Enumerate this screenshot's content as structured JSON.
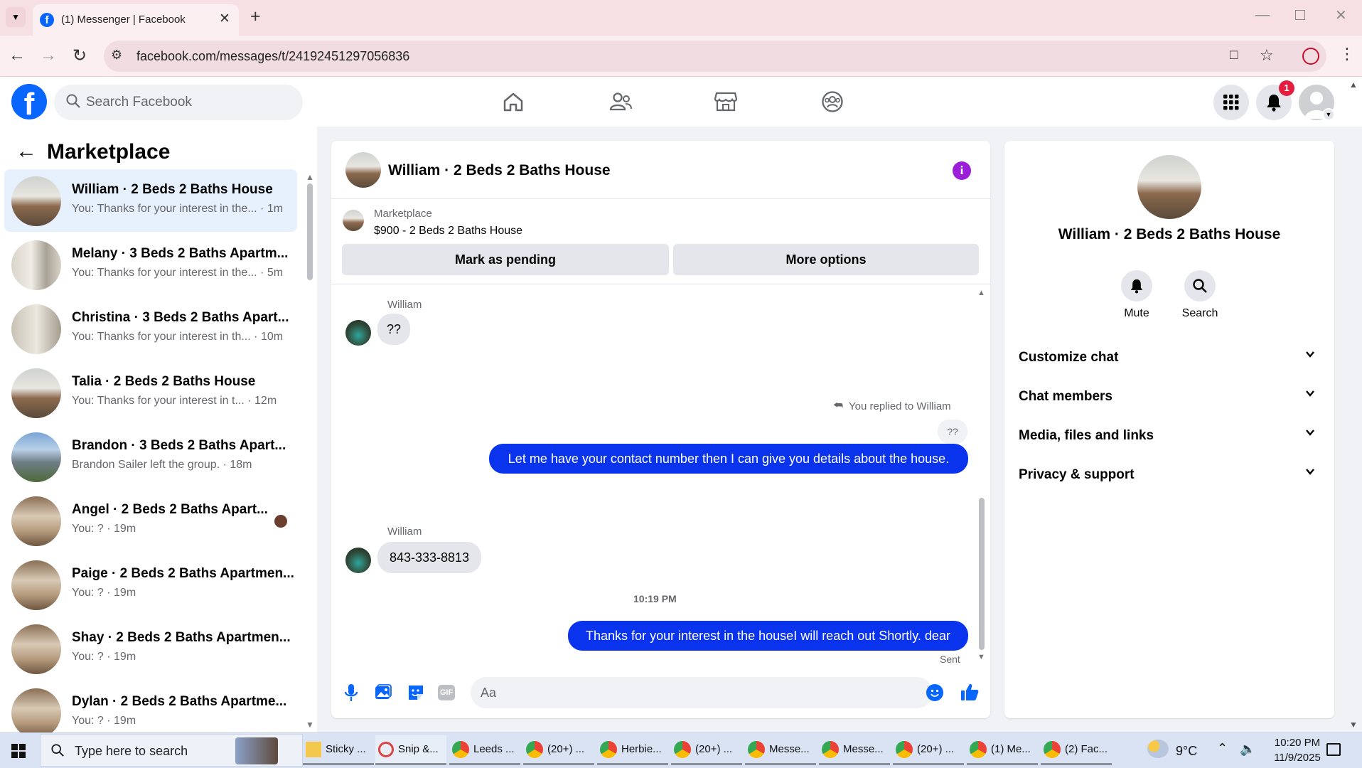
{
  "browser": {
    "tab_title": "(1) Messenger | Facebook",
    "url": "facebook.com/messages/t/24192451297056836"
  },
  "header": {
    "search_placeholder": "Search Facebook",
    "notification_count": "1"
  },
  "left": {
    "title": "Marketplace",
    "conversations": [
      {
        "name": "William · 2 Beds 2 Baths House",
        "preview": "You: Thanks for your interest in the...",
        "time": "1m"
      },
      {
        "name": "Melany · 3 Beds 2 Baths Apartm...",
        "preview": "You: Thanks for your interest in the...",
        "time": "5m"
      },
      {
        "name": "Christina · 3 Beds 2 Baths Apart...",
        "preview": "You: Thanks for your interest in th...",
        "time": "10m"
      },
      {
        "name": "Talia · 2 Beds 2 Baths House",
        "preview": "You: Thanks for your interest in t...",
        "time": "12m"
      },
      {
        "name": "Brandon · 3 Beds 2 Baths Apart...",
        "preview": "Brandon Sailer left the group.",
        "time": "18m"
      },
      {
        "name": "Angel · 2 Beds 2 Baths Apart...",
        "preview": "You: ?",
        "time": "19m"
      },
      {
        "name": "Paige · 2 Beds 2 Baths Apartmen...",
        "preview": "You: ?",
        "time": "19m"
      },
      {
        "name": "Shay · 2 Beds 2 Baths Apartmen...",
        "preview": "You: ?",
        "time": "19m"
      },
      {
        "name": "Dylan · 2 Beds 2 Baths Apartme...",
        "preview": "You: ?",
        "time": "19m"
      }
    ]
  },
  "chat": {
    "title": "William · 2 Beds 2 Baths House",
    "listing_label": "Marketplace",
    "listing_detail": "$900 - 2 Beds 2 Baths House",
    "mark_pending": "Mark as pending",
    "more_options": "More options",
    "sender1": "William",
    "msg1": "??",
    "replied_note": "You replied to William",
    "quoted": "??",
    "msg2": "Let me have your contact number then I can give you details about the house.",
    "sender2": "William",
    "msg3": "843-333-8813",
    "timestamp": "10:19 PM",
    "msg4": "Thanks for your interest in the houseI will reach out Shortly. dear",
    "sent_label": "Sent",
    "composer_placeholder": "Aa",
    "gif_label": "GIF"
  },
  "info": {
    "title": "William · 2 Beds 2 Baths House",
    "mute": "Mute",
    "search": "Search",
    "sections": [
      "Customize chat",
      "Chat members",
      "Media, files and links",
      "Privacy & support"
    ]
  },
  "taskbar": {
    "search_placeholder": "Type here to search",
    "apps": [
      "Sticky ...",
      "Snip &...",
      "Leeds ...",
      "(20+) ...",
      "Herbie...",
      "(20+) ...",
      "Messe...",
      "Messe...",
      "(20+) ...",
      "(1) Me...",
      "(2) Fac..."
    ],
    "weather": "9°C",
    "time": "10:20 PM",
    "date": "11/9/2025"
  },
  "colors": {
    "brand": "#0866ff",
    "outgoing_bubble": "#0a33ee",
    "notification": "#e41e3f"
  }
}
